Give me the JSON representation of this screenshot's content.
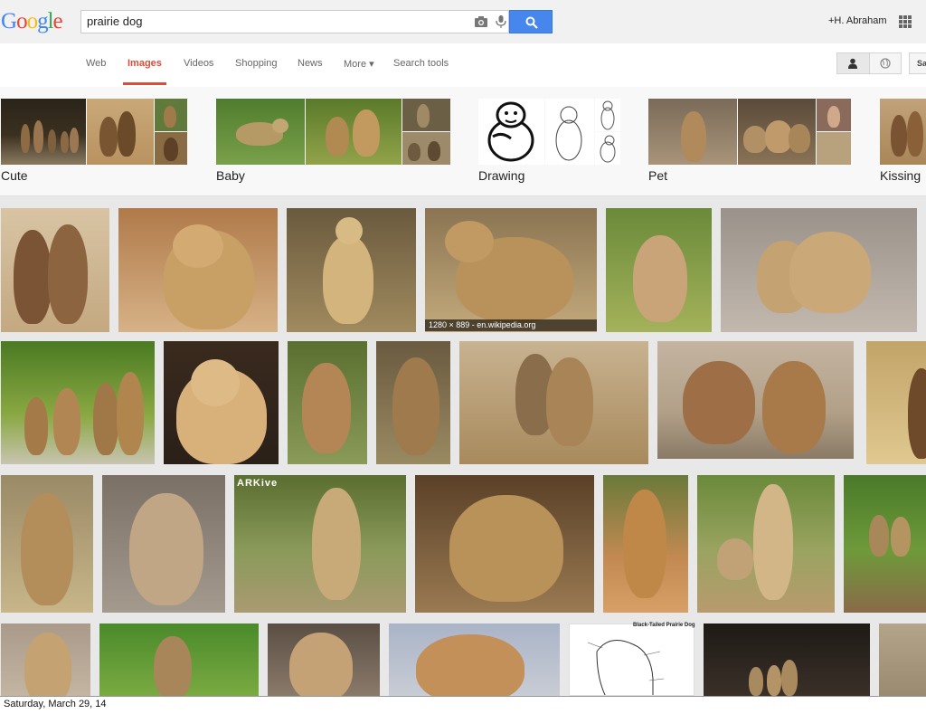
{
  "logo": {
    "letters": [
      "G",
      "o",
      "o",
      "g",
      "l",
      "e"
    ],
    "colors": [
      "#4285f4",
      "#ea4335",
      "#fbbc05",
      "#4285f4",
      "#34a853",
      "#ea4335"
    ]
  },
  "search": {
    "query": "prairie dog"
  },
  "user": {
    "name": "+H. Abraham"
  },
  "nav": {
    "tabs": [
      "Web",
      "Images",
      "Videos",
      "Shopping",
      "News",
      "More ▾",
      "Search tools"
    ],
    "active": "Images",
    "more_label": "Sa"
  },
  "related": [
    "Cute",
    "Baby",
    "Drawing",
    "Pet",
    "Kissing"
  ],
  "images": {
    "caption": "1280 × 889 - en.wikipedia.org",
    "watermark": "ARKive",
    "diagram_title": "Black-Tailed Prairie Dog"
  },
  "footer": {
    "date": "Saturday, March 29, 14"
  },
  "colors": {
    "accent": "#dd4b39",
    "search_button": "#4787ed"
  }
}
